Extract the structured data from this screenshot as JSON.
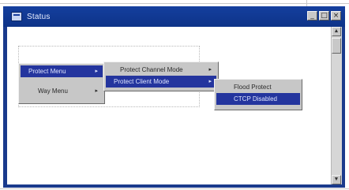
{
  "window": {
    "title": "Status",
    "buttons": {
      "minimize": "_",
      "maximize": "□",
      "close": "×"
    }
  },
  "menus": {
    "root": [
      {
        "label": "Protect Menu",
        "selected": true,
        "has_submenu": true
      },
      {
        "label": "Way Menu",
        "selected": false,
        "has_submenu": true
      }
    ],
    "protect": [
      {
        "label": "Protect Channel Mode",
        "selected": false,
        "has_submenu": true
      },
      {
        "label": "Protect Client Mode",
        "selected": true,
        "has_submenu": true
      }
    ],
    "client": [
      {
        "label": "Flood Protect",
        "selected": false
      },
      {
        "label": "CTCP Disabled",
        "selected": true
      }
    ]
  },
  "icons": {
    "submenu": "▸",
    "scroll_up": "▲",
    "scroll_down": "▼"
  },
  "colors": {
    "titlebar": "#0e3388",
    "selection": "#24359e",
    "menu_bg": "#c7c7c7"
  }
}
